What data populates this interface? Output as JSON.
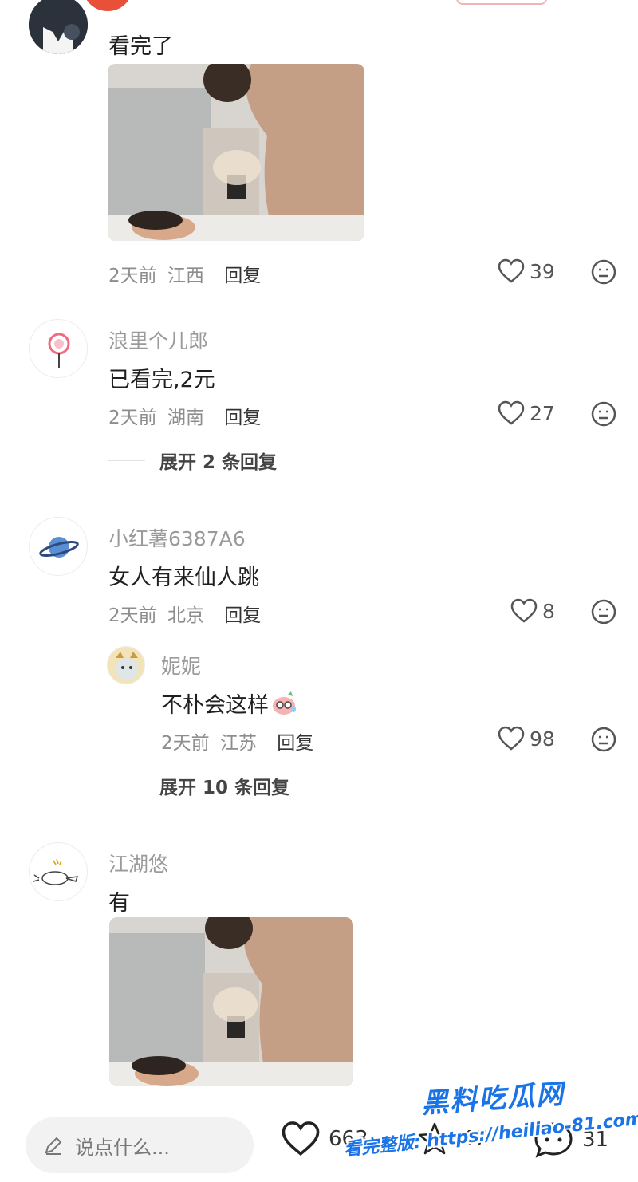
{
  "comments": [
    {
      "text": "看完了",
      "date": "2天前",
      "location": "江西",
      "reply_label": "回复",
      "likes": "39"
    },
    {
      "username": "浪里个儿郎",
      "text": "已看完,2元",
      "date": "2天前",
      "location": "湖南",
      "reply_label": "回复",
      "likes": "27",
      "expand_label": "展开 2 条回复"
    },
    {
      "username": "小红薯6387A6",
      "text": "女人有来仙人跳",
      "date": "2天前",
      "location": "北京",
      "reply_label": "回复",
      "likes": "8",
      "sub_reply": {
        "username": "妮妮",
        "text": "不朴会这样",
        "date": "2天前",
        "location": "江苏",
        "reply_label": "回复",
        "likes": "98"
      },
      "expand_label": "展开 10 条回复"
    },
    {
      "username": "江湖悠",
      "text": "有"
    }
  ],
  "bottom_bar": {
    "input_placeholder": "说点什么...",
    "like_count": "663",
    "star_count": "47",
    "comment_count": "31"
  },
  "watermark": {
    "title": "黑料吃瓜网",
    "url": "看完整版: https://heiliao-81.com"
  },
  "colors": {
    "watermark": "#1a74e8",
    "accent_red": "#e8503a"
  }
}
